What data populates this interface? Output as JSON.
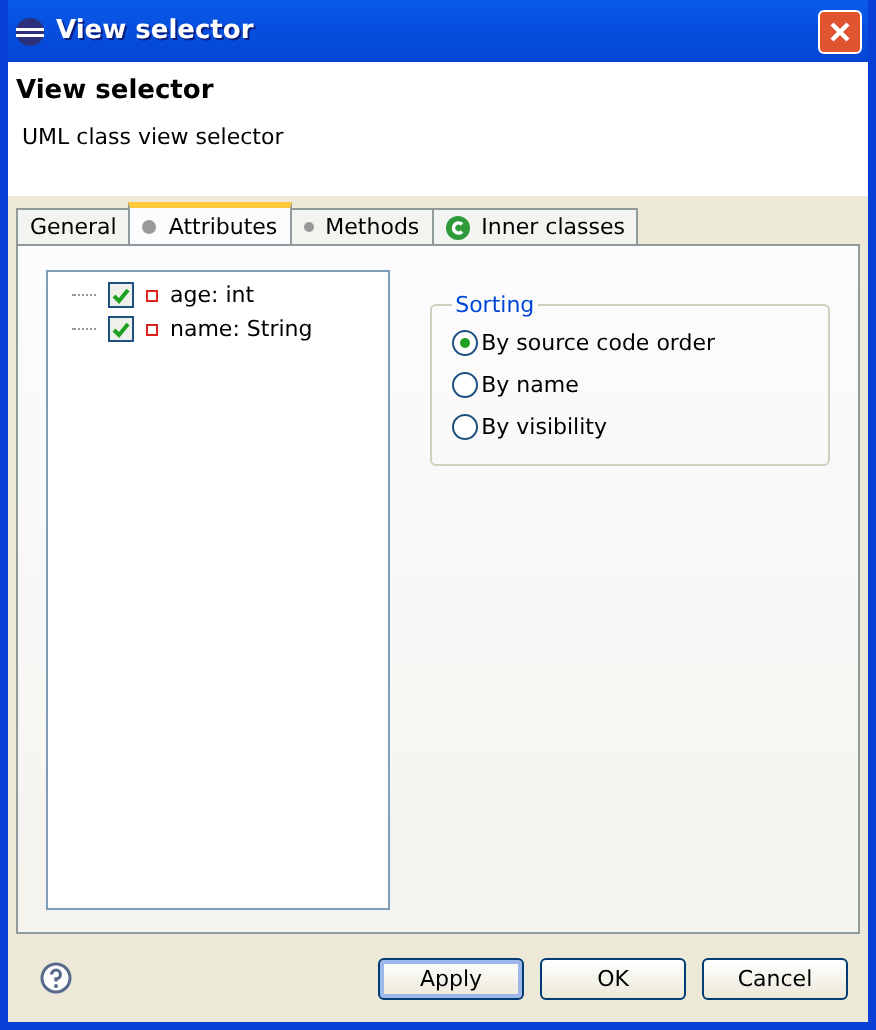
{
  "window": {
    "title": "View selector"
  },
  "header": {
    "title": "View selector",
    "description": "UML class view selector"
  },
  "tabs": [
    {
      "label": "General",
      "selected": false
    },
    {
      "label": "Attributes",
      "selected": true
    },
    {
      "label": "Methods",
      "selected": false
    },
    {
      "label": "Inner classes",
      "selected": false
    }
  ],
  "attributes": [
    {
      "label": "age: int",
      "checked": true
    },
    {
      "label": "name: String",
      "checked": true
    }
  ],
  "sorting": {
    "title": "Sorting",
    "options": [
      {
        "label": "By source code order",
        "selected": true
      },
      {
        "label": "By name",
        "selected": false
      },
      {
        "label": "By visibility",
        "selected": false
      }
    ]
  },
  "buttons": [
    {
      "label": "Apply",
      "default": true
    },
    {
      "label": "OK",
      "default": false
    },
    {
      "label": "Cancel",
      "default": false
    }
  ]
}
